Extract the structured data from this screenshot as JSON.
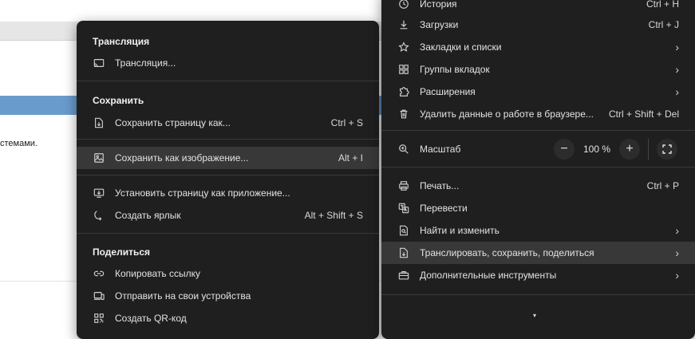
{
  "background": {
    "partial_text": "стемами."
  },
  "submenu": {
    "sections": {
      "cast": "Трансляция",
      "save": "Сохранить",
      "share": "Поделиться"
    },
    "items": {
      "cast": {
        "label": "Трансляция..."
      },
      "save_page": {
        "label": "Сохранить страницу как...",
        "shortcut": "Ctrl + S"
      },
      "save_image": {
        "label": "Сохранить как изображение...",
        "shortcut": "Alt + I"
      },
      "install_app": {
        "label": "Установить страницу как приложение..."
      },
      "create_shortcut": {
        "label": "Создать ярлык",
        "shortcut": "Alt + Shift + S"
      },
      "copy_link": {
        "label": "Копировать ссылку"
      },
      "send_devices": {
        "label": "Отправить на свои устройства"
      },
      "qr_code": {
        "label": "Создать QR-код"
      }
    }
  },
  "mainmenu": {
    "items": {
      "history": {
        "label": "История",
        "shortcut": "Ctrl + H"
      },
      "downloads": {
        "label": "Загрузки",
        "shortcut": "Ctrl + J"
      },
      "bookmarks": {
        "label": "Закладки и списки"
      },
      "tab_groups": {
        "label": "Группы вкладок"
      },
      "extensions": {
        "label": "Расширения"
      },
      "clear_data": {
        "label": "Удалить данные о работе в браузере...",
        "shortcut": "Ctrl + Shift + Del"
      },
      "print": {
        "label": "Печать...",
        "shortcut": "Ctrl + P"
      },
      "translate": {
        "label": "Перевести"
      },
      "find_edit": {
        "label": "Найти и изменить"
      },
      "cast_save_share": {
        "label": "Транслировать, сохранить, поделиться"
      },
      "more_tools": {
        "label": "Дополнительные инструменты"
      }
    },
    "zoom": {
      "label": "Масштаб",
      "value": "100 %",
      "minus": "−",
      "plus": "+"
    },
    "scroll_more": "▾"
  },
  "colors": {
    "menu_bg": "#1f1f1f",
    "highlight": "#383838",
    "separator": "#3a3a3a",
    "accent_bar": "#6a9bcd"
  }
}
